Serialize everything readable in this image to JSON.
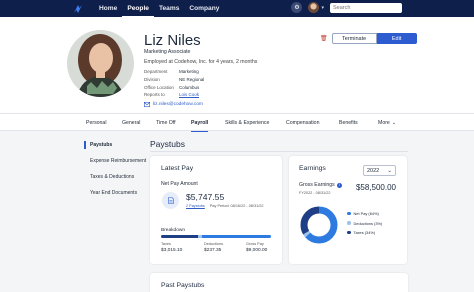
{
  "nav": {
    "links": [
      "Home",
      "People",
      "Teams",
      "Company"
    ],
    "active": "People",
    "search_placeholder": "Search"
  },
  "profile": {
    "name": "Liz Niles",
    "title": "Marketing Associate",
    "employed": "Employed at Codehow, Inc. for 4 years, 2 months",
    "info": [
      {
        "label": "Department",
        "value": "Marketing"
      },
      {
        "label": "Division",
        "value": "NE Regional"
      },
      {
        "label": "Office Location",
        "value": "Columbus"
      },
      {
        "label": "Reports to",
        "value": "Lois Cook"
      }
    ],
    "email": "liz.niles@codehow.com",
    "terminate_label": "Terminate",
    "edit_label": "Edit"
  },
  "tabs": [
    "Personal",
    "General",
    "Time Off",
    "Payroll",
    "Skills & Experience",
    "Compensation",
    "Benefits",
    "More"
  ],
  "active_tab": "Payroll",
  "submenu": [
    "Paystubs",
    "Expense Reimbursement",
    "Taxes & Deductions",
    "Year End Documents"
  ],
  "section_title": "Paystubs",
  "latest_pay": {
    "title": "Latest Pay",
    "net_label": "Net Pay Amount",
    "net_amount": "$5,747.55",
    "paystubs_link": "2 Paystubs",
    "pay_period": "Pay Period: 08/16/22 - 08/31/22",
    "breakdown_label": "Breakdown",
    "breakdown": [
      {
        "label": "Taxes",
        "value": "$3,015.10",
        "share": 0.34,
        "color": "#1e3e86"
      },
      {
        "label": "Deductions",
        "value": "$237.35",
        "share": 0.03,
        "color": "#9fc3ea"
      },
      {
        "label": "Gross Pay",
        "value": "$9,000.00",
        "share": 0.63,
        "color": "#2d7be0"
      }
    ]
  },
  "earnings": {
    "title": "Earnings",
    "year": "2022",
    "gross_label": "Gross Earnings",
    "gross_amount": "$58,500.00",
    "ytd": "FY2022 - 08/31/22",
    "legend": [
      {
        "label": "Net Pay (64%)",
        "value": 64,
        "color": "#2d7be0"
      },
      {
        "label": "Deductions (3%)",
        "value": 3,
        "color": "#9fc3ea"
      },
      {
        "label": "Taxes (34%)",
        "value": 34,
        "color": "#1e3e86"
      }
    ]
  },
  "past_paystubs_title": "Past Paystubs"
}
